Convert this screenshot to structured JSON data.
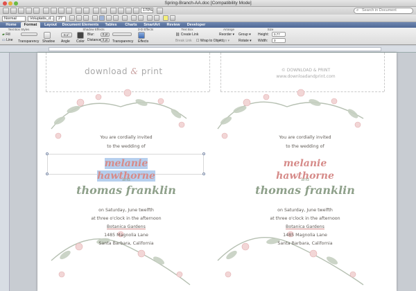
{
  "window": {
    "title": "Spring-Branch-AA.doc [Compatibility Mode]"
  },
  "search": {
    "placeholder": "Search in Document"
  },
  "toolbar": {
    "style_value": "Normal",
    "font_value": "Voluptatis_d...",
    "size_value": "27",
    "zoom_value": "170%"
  },
  "tabs": [
    "Home",
    "Format",
    "Layout",
    "Document Elements",
    "Tables",
    "Charts",
    "SmartArt",
    "Review",
    "Developer"
  ],
  "active_tab": "Format",
  "ribbon": {
    "groups": [
      "Text Box Styles",
      "Shadow Effects",
      "3-D Effects",
      "Text Box",
      "Arrange",
      "Size"
    ],
    "fill_label": "Fill",
    "line_label": "Line",
    "transparency_label": "Transparency",
    "shadow_label": "Shadow",
    "angle_label": "Angle",
    "angle_value": "0.1°",
    "color_label": "Color",
    "blur_label": "Blur:",
    "blur_value": "0 pt",
    "distance_label": "Distance:",
    "distance_value": "0 pt",
    "transparency2_label": "Transparency",
    "effects_label": "Effects",
    "create_link_label": "Create Link",
    "break_link_label": "Break Link",
    "wrap_label": "Wrap to Object",
    "reorder_label": "Reorder",
    "align_label": "Align",
    "group_label": "Group",
    "rotate_label": "Rotate",
    "height_label": "Height:",
    "height_value": "0.77",
    "width_label": "Width:",
    "width_value": "3"
  },
  "card_left": {
    "logo_a": "download",
    "logo_b": "print",
    "line1": "You are cordially invited",
    "line2": "to the wedding of",
    "bride": "melanie hawthorne",
    "and": "and",
    "groom": "thomas franklin",
    "date": "on Saturday, June twelfth",
    "time": "at three o'clock in the afternoon",
    "venue": "Botanica Gardens",
    "street": "1485 Magnolia Lane",
    "city": "Santa Barbara, California"
  },
  "card_right": {
    "copyright": "© DOWNLOAD & PRINT",
    "url": "www.downloadandprint.com",
    "line1": "You are cordially invited",
    "line2": "to the wedding of",
    "bride": "melanie hawthorne",
    "and": "and",
    "groom": "thomas franklin",
    "date": "on Saturday, June twelfth",
    "time": "at three o'clock in the afternoon",
    "venue": "Botanica Gardens",
    "street": "1485 Magnolia Lane",
    "city": "Santa Barbara, California"
  },
  "colors": {
    "accent_pink": "#d68b89",
    "accent_green": "#8ea08a",
    "selection": "#b6cfee",
    "ribbon_tab": "#4f6896"
  }
}
